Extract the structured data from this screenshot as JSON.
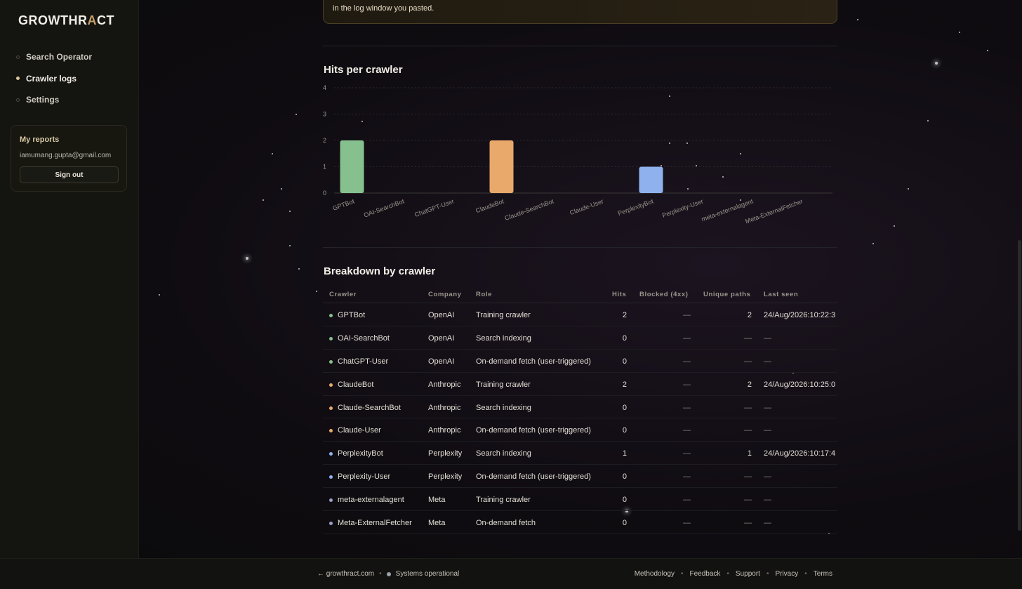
{
  "app": {
    "logo_main": "GROWTHR",
    "logo_accent": "A",
    "logo_end": "CT"
  },
  "sidebar": {
    "items": [
      {
        "label": "Search Operator",
        "active": false
      },
      {
        "label": "Crawler logs",
        "active": true
      },
      {
        "label": "Settings",
        "active": false
      }
    ],
    "reports": {
      "title": "My reports",
      "email": "iamumang.gupta@gmail.com",
      "sign_out": "Sign out"
    }
  },
  "log_notice": "in the log window you pasted.",
  "hits_section": {
    "title": "Hits per crawler"
  },
  "breakdown_section": {
    "title": "Breakdown by crawler"
  },
  "chart_data": {
    "type": "bar",
    "title": "Hits per crawler",
    "categories": [
      "GPTBot",
      "OAI-SearchBot",
      "ChatGPT-User",
      "ClaudeBot",
      "Claude-SearchBot",
      "Claude-User",
      "PerplexityBot",
      "Perplexity-User",
      "meta-externalagent",
      "Meta-ExternalFetcher"
    ],
    "values": [
      2,
      0,
      0,
      2,
      0,
      0,
      1,
      0,
      0,
      0
    ],
    "colors": [
      "#86c08e",
      "#86c08e",
      "#86c08e",
      "#e8a96a",
      "#e8a96a",
      "#e8a96a",
      "#8fb2ef",
      "#8fb2ef",
      "#9aa0c8",
      "#9aa0c8"
    ],
    "yticks": [
      "0",
      "1",
      "2",
      "3",
      "4"
    ],
    "ylim": [
      0,
      4
    ],
    "grid": true
  },
  "table": {
    "headers": {
      "crawler": "Crawler",
      "company": "Company",
      "role": "Role",
      "hits": "Hits",
      "blocked": "Blocked (4xx)",
      "unique": "Unique paths",
      "last_seen": "Last seen"
    },
    "rows": [
      {
        "crawler": "GPTBot",
        "company": "OpenAI",
        "role": "Training crawler",
        "hits": "2",
        "blocked": "—",
        "unique": "2",
        "last_seen": "24/Aug/2026:10:22:3",
        "color": "#86c08e"
      },
      {
        "crawler": "OAI-SearchBot",
        "company": "OpenAI",
        "role": "Search indexing",
        "hits": "0",
        "blocked": "—",
        "unique": "—",
        "last_seen": "—",
        "color": "#86c08e"
      },
      {
        "crawler": "ChatGPT-User",
        "company": "OpenAI",
        "role": "On-demand fetch (user-triggered)",
        "hits": "0",
        "blocked": "—",
        "unique": "—",
        "last_seen": "—",
        "color": "#86c08e"
      },
      {
        "crawler": "ClaudeBot",
        "company": "Anthropic",
        "role": "Training crawler",
        "hits": "2",
        "blocked": "—",
        "unique": "2",
        "last_seen": "24/Aug/2026:10:25:0",
        "color": "#e8a96a"
      },
      {
        "crawler": "Claude-SearchBot",
        "company": "Anthropic",
        "role": "Search indexing",
        "hits": "0",
        "blocked": "—",
        "unique": "—",
        "last_seen": "—",
        "color": "#e8a96a"
      },
      {
        "crawler": "Claude-User",
        "company": "Anthropic",
        "role": "On-demand fetch (user-triggered)",
        "hits": "0",
        "blocked": "—",
        "unique": "—",
        "last_seen": "—",
        "color": "#e8a96a"
      },
      {
        "crawler": "PerplexityBot",
        "company": "Perplexity",
        "role": "Search indexing",
        "hits": "1",
        "blocked": "—",
        "unique": "1",
        "last_seen": "24/Aug/2026:10:17:4",
        "color": "#8fb2ef"
      },
      {
        "crawler": "Perplexity-User",
        "company": "Perplexity",
        "role": "On-demand fetch (user-triggered)",
        "hits": "0",
        "blocked": "—",
        "unique": "—",
        "last_seen": "—",
        "color": "#8fb2ef"
      },
      {
        "crawler": "meta-externalagent",
        "company": "Meta",
        "role": "Training crawler",
        "hits": "0",
        "blocked": "—",
        "unique": "—",
        "last_seen": "—",
        "color": "#9aa0c8"
      },
      {
        "crawler": "Meta-ExternalFetcher",
        "company": "Meta",
        "role": "On-demand fetch",
        "hits": "0",
        "blocked": "—",
        "unique": "—",
        "last_seen": "—",
        "color": "#9aa0c8"
      }
    ]
  },
  "footer": {
    "home_link": "← growthract.com",
    "status": "Systems operational",
    "links": [
      "Methodology",
      "Feedback",
      "Support",
      "Privacy",
      "Terms"
    ]
  }
}
